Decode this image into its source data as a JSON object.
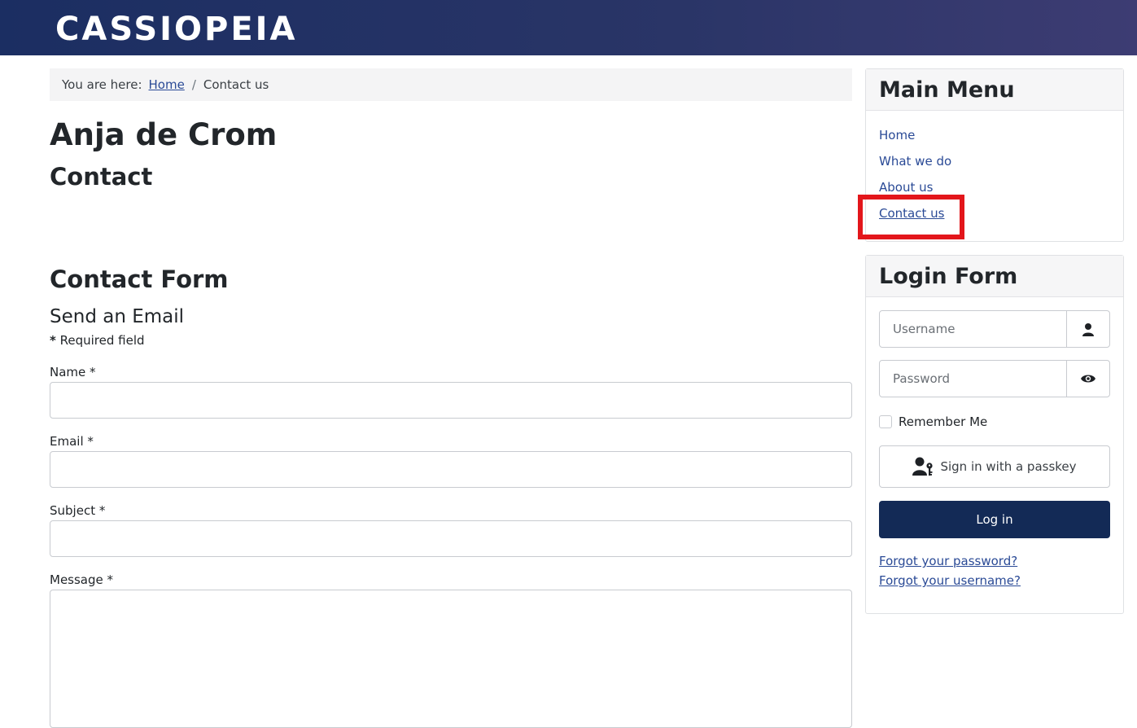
{
  "header": {
    "brand": "CASSIOPEIA"
  },
  "breadcrumb": {
    "prefix": "You are here:",
    "home": "Home",
    "current": "Contact us"
  },
  "main": {
    "page_title": "Anja de Crom",
    "contact_title": "Contact",
    "form_title": "Contact Form",
    "form_legend": "Send an Email",
    "required_mark": "*",
    "required_text": " Required field",
    "fields": {
      "name_label": "Name *",
      "email_label": "Email *",
      "subject_label": "Subject *",
      "message_label": "Message *"
    }
  },
  "main_menu": {
    "title": "Main Menu",
    "items": [
      {
        "label": "Home"
      },
      {
        "label": "What we do"
      },
      {
        "label": "About us"
      },
      {
        "label": "Contact us",
        "active": true
      }
    ],
    "highlight_color": "#e3161b"
  },
  "login": {
    "title": "Login Form",
    "username_placeholder": "Username",
    "password_placeholder": "Password",
    "remember_me": "Remember Me",
    "passkey_label": "Sign in with a passkey",
    "login_button": "Log in",
    "forgot_password": "Forgot your password?",
    "forgot_username": "Forgot your username?",
    "icons": {
      "username": "user-icon",
      "password": "eye-icon",
      "passkey": "user-key-icon"
    }
  },
  "colors": {
    "header_start": "#1b2e62",
    "header_end": "#3d3c73",
    "link": "#2a4a96",
    "button": "#132a56"
  }
}
